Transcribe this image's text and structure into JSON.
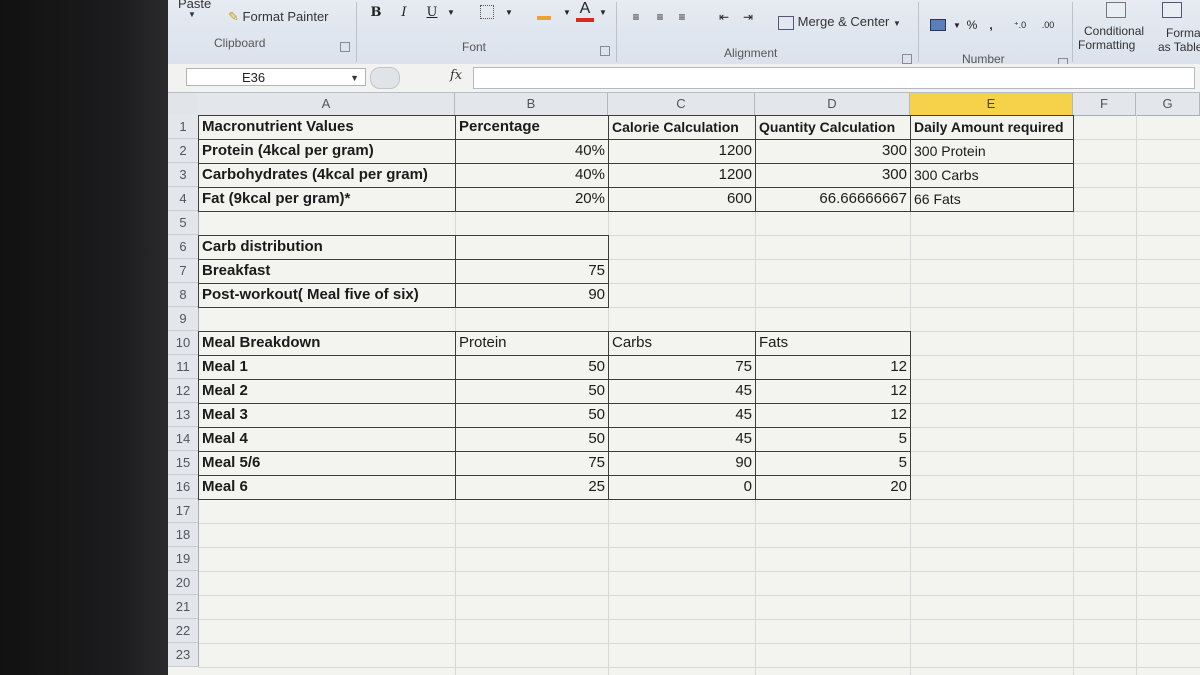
{
  "ribbon": {
    "paste": "Paste",
    "format_painter": "Format Painter",
    "clipboard": "Clipboard",
    "bold": "B",
    "italic": "I",
    "underline": "U",
    "font_color_letter": "A",
    "font": "Font",
    "merge_center": "Merge & Center",
    "alignment": "Alignment",
    "percent": "%",
    "comma": ",",
    "number": "Number",
    "conditional_formatting": "Conditional",
    "conditional_formatting_2": "Formatting",
    "format_as_table": "Format",
    "format_as_table_2": "as Table",
    "accent_fill": "#f0a030",
    "accent_font": "#d62b1f"
  },
  "formula_bar": {
    "name_box": "E36",
    "fx": "fx",
    "value": ""
  },
  "columns": [
    "A",
    "B",
    "C",
    "D",
    "E",
    "F",
    "G"
  ],
  "rows": [
    "1",
    "2",
    "3",
    "4",
    "5",
    "6",
    "7",
    "8",
    "9",
    "10",
    "11",
    "12",
    "13",
    "14",
    "15",
    "16",
    "17",
    "18",
    "19",
    "20",
    "21",
    "22",
    "23"
  ],
  "macro_table": {
    "headers": [
      "Macronutrient Values",
      "Percentage",
      "Calorie Calculation",
      "Quantity Calculation",
      "Daily Amount required"
    ],
    "rows": [
      [
        "Protein (4kcal per gram)",
        "40%",
        "1200",
        "300",
        "300 Protein"
      ],
      [
        "Carbohydrates (4kcal per gram)",
        "40%",
        "1200",
        "300",
        "300 Carbs"
      ],
      [
        "Fat (9kcal per gram)*",
        "20%",
        "600",
        "66.66666667",
        "66 Fats"
      ]
    ]
  },
  "carb_table": {
    "title": "Carb distribution",
    "rows": [
      [
        "Breakfast",
        "75"
      ],
      [
        "Post-workout( Meal five of six)",
        "90"
      ]
    ]
  },
  "meal_table": {
    "headers": [
      "Meal Breakdown",
      "Protein",
      "Carbs",
      "Fats"
    ],
    "rows": [
      [
        "Meal 1",
        "50",
        "75",
        "12"
      ],
      [
        "Meal 2",
        "50",
        "45",
        "12"
      ],
      [
        "Meal 3",
        "50",
        "45",
        "12"
      ],
      [
        "Meal 4",
        "50",
        "45",
        "5"
      ],
      [
        "Meal 5/6",
        "75",
        "90",
        "5"
      ],
      [
        "Meal 6",
        "25",
        "0",
        "20"
      ]
    ]
  }
}
